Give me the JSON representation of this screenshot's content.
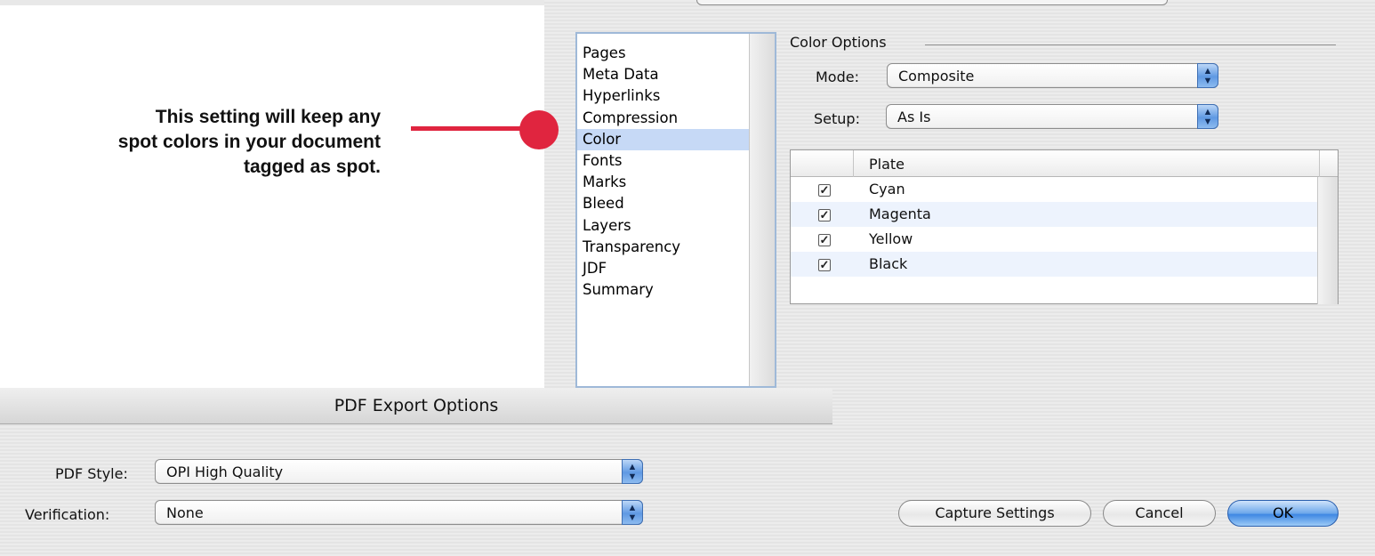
{
  "annotation": {
    "line1": "This setting will keep any",
    "line2": "spot colors in your document",
    "line3": "tagged as spot."
  },
  "window": {
    "title": "PDF Export Options"
  },
  "categories": [
    {
      "label": "Pages"
    },
    {
      "label": "Meta Data"
    },
    {
      "label": "Hyperlinks"
    },
    {
      "label": "Compression"
    },
    {
      "label": "Color",
      "selected": true
    },
    {
      "label": "Fonts"
    },
    {
      "label": "Marks"
    },
    {
      "label": "Bleed"
    },
    {
      "label": "Layers"
    },
    {
      "label": "Transparency"
    },
    {
      "label": "JDF"
    },
    {
      "label": "Summary"
    }
  ],
  "color_options": {
    "group_label": "Color Options",
    "mode_label": "Mode:",
    "mode_value": "Composite",
    "setup_label": "Setup:",
    "setup_value": "As Is",
    "plate_header": "Plate",
    "plates": [
      {
        "name": "Cyan",
        "checked": true
      },
      {
        "name": "Magenta",
        "checked": true
      },
      {
        "name": "Yellow",
        "checked": true
      },
      {
        "name": "Black",
        "checked": true
      }
    ]
  },
  "bottom": {
    "pdf_style_label": "PDF Style:",
    "pdf_style_value": "OPI High Quality",
    "verification_label": "Verification:",
    "verification_value": "None",
    "capture_label": "Capture Settings",
    "cancel_label": "Cancel",
    "ok_label": "OK"
  },
  "colors": {
    "annotation_red": "#e0253f",
    "selection_blue": "#c6d9f6",
    "default_button_blue": "#3f87e3"
  },
  "icons": {
    "popup_arrows": "updown-arrows-icon",
    "checkbox": "checkmark-icon"
  }
}
